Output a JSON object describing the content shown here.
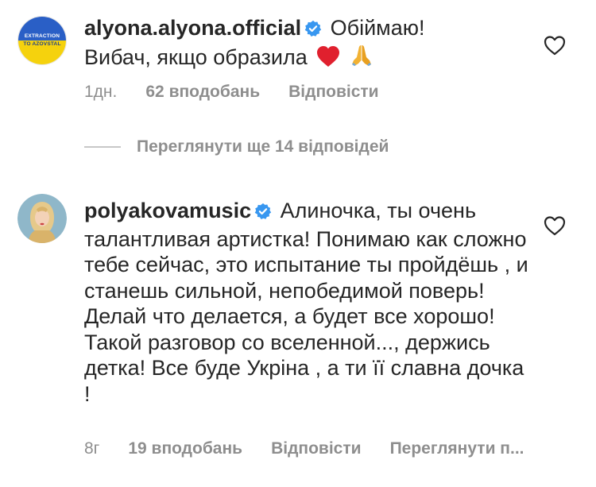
{
  "comments": [
    {
      "avatar_label_top": "EXTRACTION",
      "avatar_label_bottom": "TO AZOVSTAL",
      "username": "alyona.alyona.official",
      "text_line1": "Обіймаю!",
      "text_line2": "Вибач, якщо образила",
      "emoji_1": "❤️",
      "emoji_2": "🙏",
      "time": "1дн.",
      "likes": "62 вподобань",
      "reply_label": "Відповісти",
      "replies_toggle": "Переглянути ще 14 відповідей"
    },
    {
      "username": "polyakovamusic",
      "text": "Алиночка, ты очень талантливая артистка! Понимаю как сложно тебе сейчас, это испытание ты пройдёшь ,  и станешь сильной, непобедимой поверь! Делай что делается, а будет все хорошо! Такой разговор со вселенной..., держись детка! Все буде Укріна , а ти її славна дочка !",
      "time": "8г",
      "likes": "19 вподобань",
      "reply_label": "Відповісти",
      "translate_label": "Переглянути п..."
    }
  ],
  "colors": {
    "text": "#262626",
    "muted": "#8e8e8e",
    "verified": "#3897f0",
    "flag_blue": "#2a5fc6",
    "flag_yellow": "#f5d20d"
  }
}
